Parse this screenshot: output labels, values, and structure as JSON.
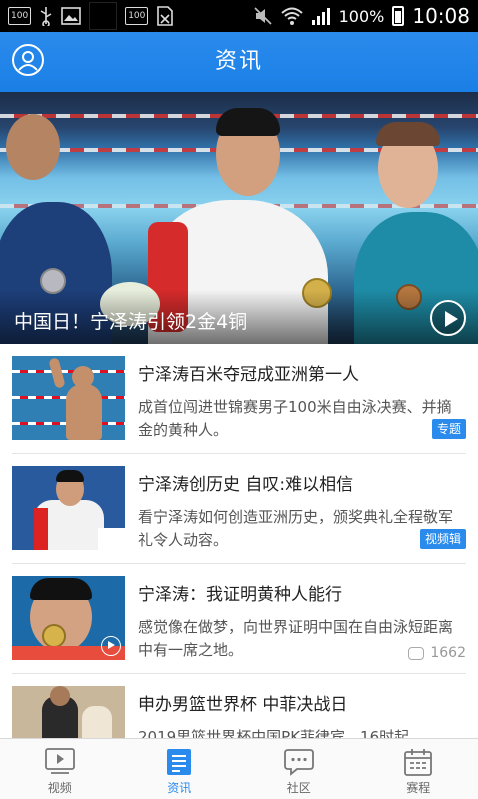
{
  "status_bar": {
    "icons": [
      "battery-100-icon",
      "usb-icon",
      "image-icon",
      "blank-icon",
      "battery-icon",
      "no-sim-icon",
      "mute-icon",
      "wifi-icon",
      "signal-icon"
    ],
    "small_badge_1": "100",
    "small_badge_2": "100",
    "battery_percent": "100%",
    "time": "10:08"
  },
  "header": {
    "title": "资讯",
    "avatar_icon": "user-avatar-icon"
  },
  "hero": {
    "title": "中国日！宁泽涛引领2金4铜",
    "play_icon": "play-circle-icon"
  },
  "news": [
    {
      "title": "宁泽涛百米夺冠成亚洲第一人",
      "description": "成首位闯进世锦赛男子100米自由泳决赛、并摘金的黄种人。",
      "tag": "专题"
    },
    {
      "title": "宁泽涛创历史 自叹:难以相信",
      "description": "看宁泽涛如何创造亚洲历史，颁奖典礼全程敬军礼令人动容。",
      "tag": "视频辑"
    },
    {
      "title": "宁泽涛：我证明黄种人能行",
      "description": "感觉像在做梦，向世界证明中国在自由泳短距离中有一席之地。",
      "comments": "1662"
    },
    {
      "title": "申办男篮世界杯 中菲决战日",
      "description": "2019男篮世界杯中国PK菲律宾，16时起"
    }
  ],
  "tabbar": {
    "tabs": [
      {
        "label": "视频",
        "icon": "video-icon",
        "active": false
      },
      {
        "label": "资讯",
        "icon": "news-icon",
        "active": true
      },
      {
        "label": "社区",
        "icon": "chat-icon",
        "active": false
      },
      {
        "label": "赛程",
        "icon": "calendar-icon",
        "active": false
      }
    ]
  },
  "colors": {
    "accent": "#2b8bec",
    "statusbar": "#000000",
    "text": "#222222",
    "subtext": "#555555"
  }
}
